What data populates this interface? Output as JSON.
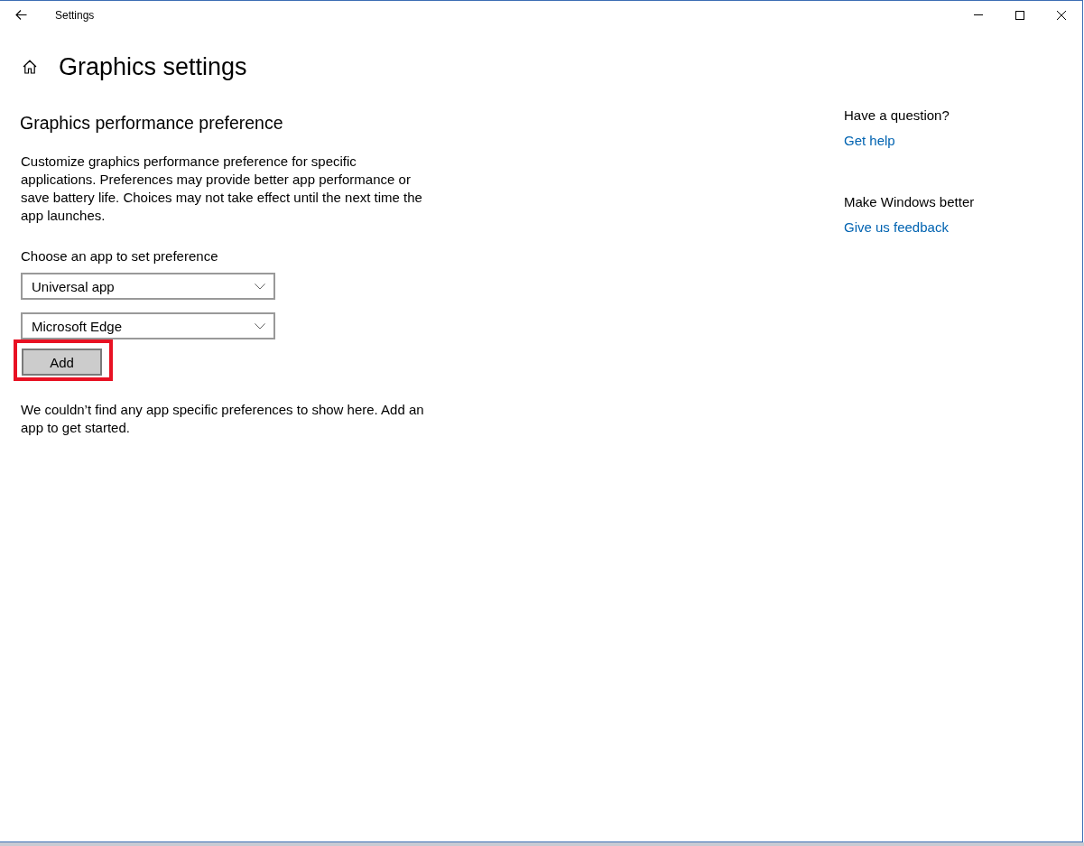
{
  "window": {
    "title": "Settings"
  },
  "page": {
    "title": "Graphics settings"
  },
  "section": {
    "heading": "Graphics performance preference",
    "description": "Customize graphics performance preference for specific applications. Preferences may provide better app performance or save battery life. Choices may not take effect until the next time the app launches.",
    "choose_label": "Choose an app to set preference",
    "dropdowns": [
      {
        "value": "Universal app"
      },
      {
        "value": "Microsoft Edge"
      }
    ],
    "add_button": {
      "label": "Add",
      "highlighted": true
    },
    "empty_message": "We couldn’t find any app specific preferences to show here. Add an app to get started."
  },
  "sidebar": {
    "groups": [
      {
        "heading": "Have a question?",
        "link": "Get help"
      },
      {
        "heading": "Make Windows better",
        "link": "Give us feedback"
      }
    ]
  }
}
